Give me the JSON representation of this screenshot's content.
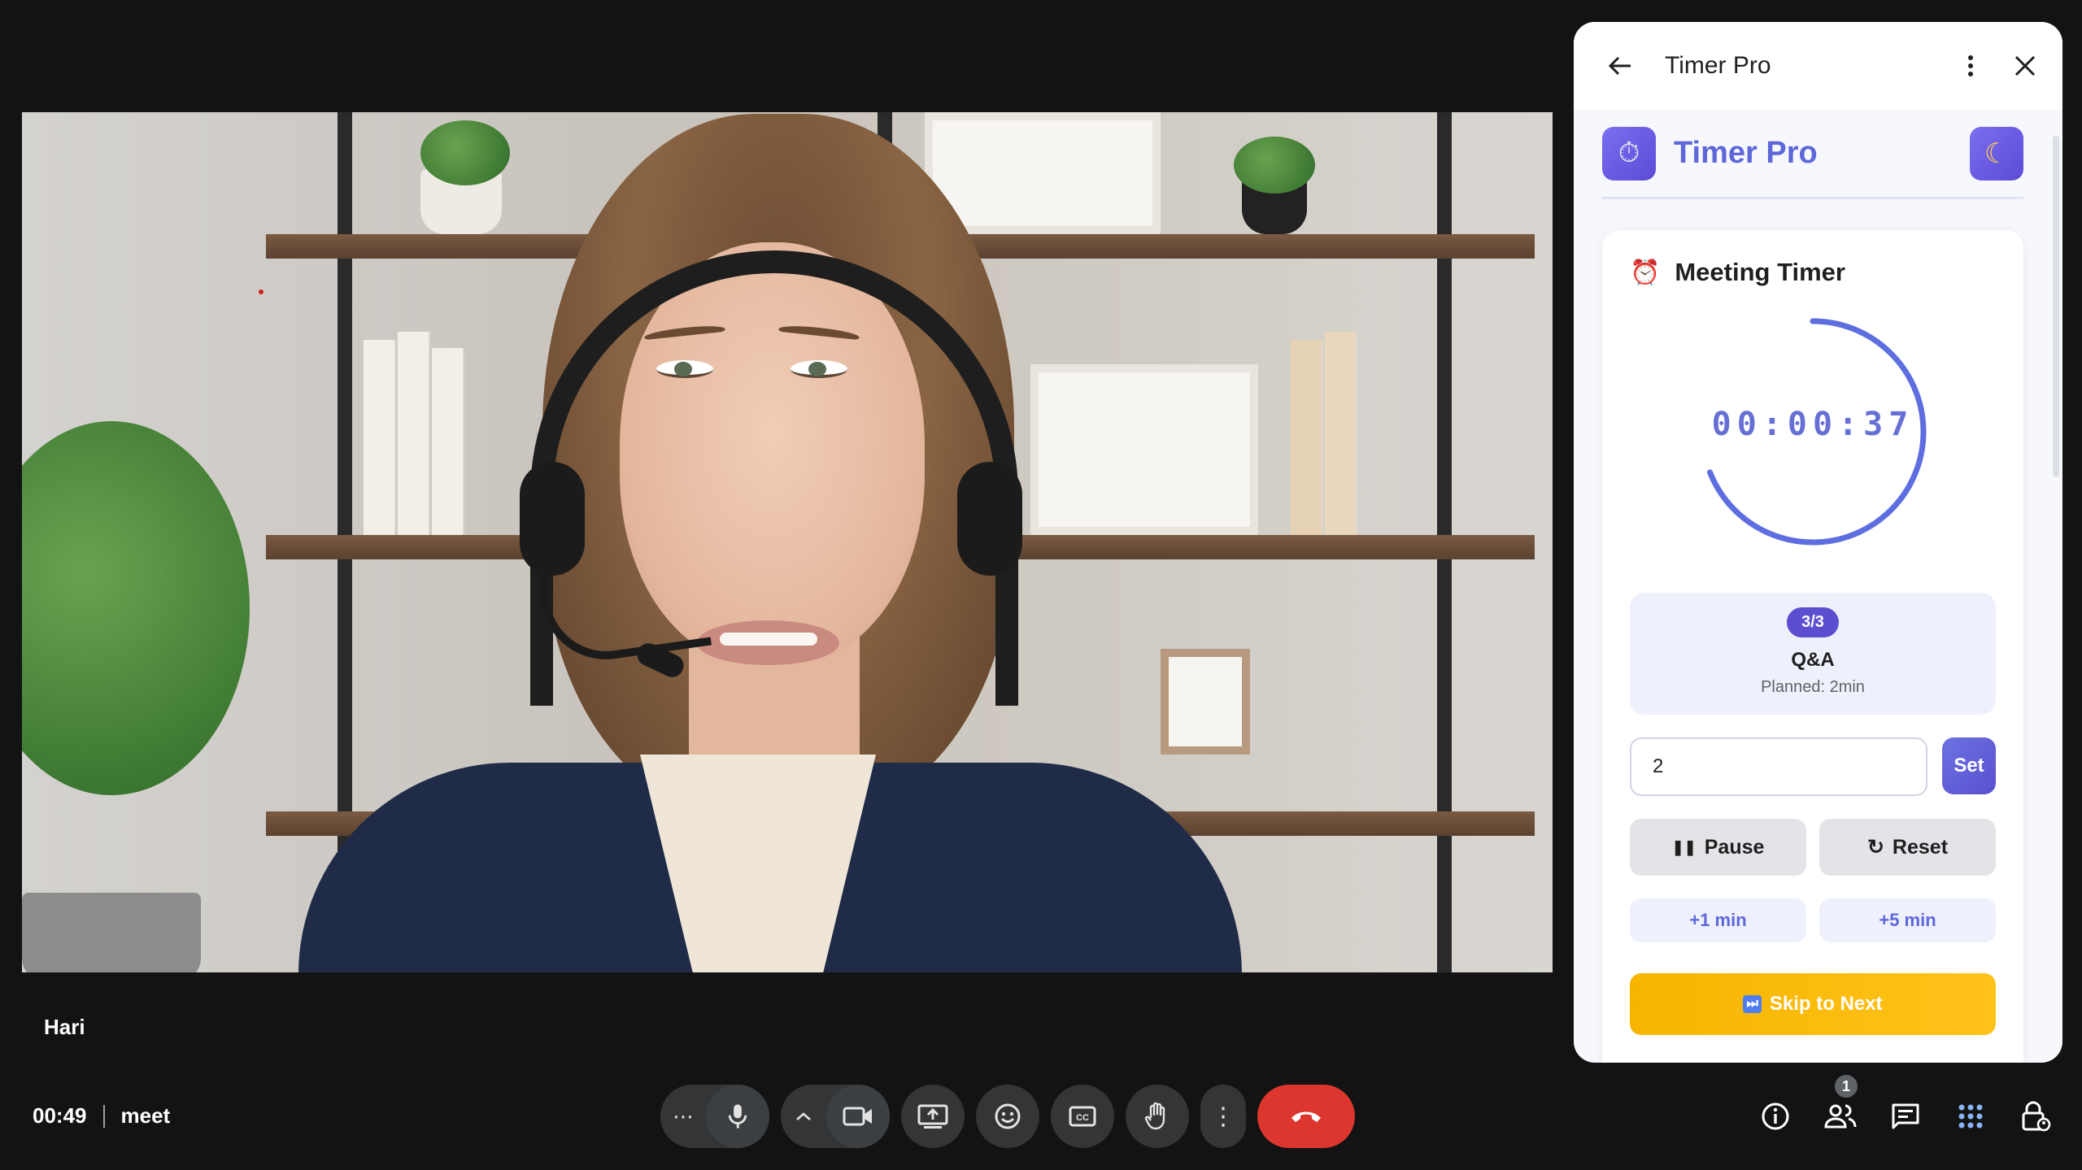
{
  "participant": {
    "name": "Hari"
  },
  "meeting": {
    "elapsed": "00:49",
    "code": "meet"
  },
  "controls": {
    "more_label": "⋯",
    "mic_icon": "mic-icon",
    "caret_label": "^",
    "camera_icon": "camera-icon",
    "present_icon": "present-icon",
    "emoji_icon": "emoji-icon",
    "captions_icon": "captions-icon",
    "hand_icon": "raise-hand-icon",
    "options_label": "⋮",
    "leave_icon": "phone-hangup-icon"
  },
  "right_icons": {
    "people_count": "1"
  },
  "panel": {
    "header_title": "Timer Pro",
    "app_name": "Timer Pro",
    "card_title": "Meeting Timer",
    "time": "00:00:37",
    "progress_fraction": 0.69,
    "agenda": {
      "step": "3/3",
      "name": "Q&A",
      "planned": "Planned: 2min"
    },
    "minutes_value": "2",
    "set_label": "Set",
    "pause_label": "Pause",
    "reset_label": "Reset",
    "add1_label": "+1 min",
    "add5_label": "+5 min",
    "skip_label": "Skip to Next"
  },
  "colors": {
    "accent": "#5e67d9",
    "leave": "#dc362e",
    "skip": "#f7b500",
    "ring": "#5e6ee0"
  }
}
